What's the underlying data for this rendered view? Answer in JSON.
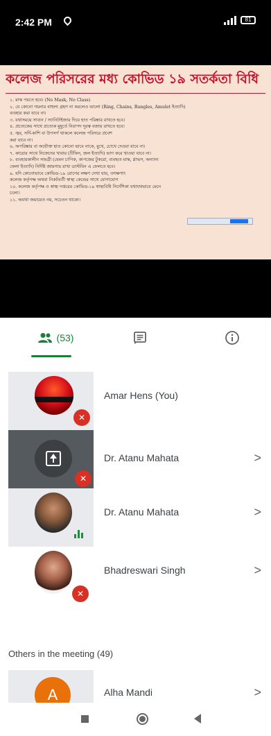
{
  "status_bar": {
    "time": "2:42 PM",
    "battery": "81"
  },
  "slide": {
    "title": "কলেজ পরিসরের মধ্য কোভিড ১৯ সতর্কতা বিধি",
    "lines": [
      "১. মাস্ক পরতে হবে। (No Mask, No Class)",
      "২. যে কোনো গয়নার বাহুল্য গ্রহণ না করলেও ভালো (Ring, Chains, Bangles, Amulet ইত্যাদি)",
      "   ব্যবহার করা যাবে না।",
      "৩. যথাসময়ে সাবান / স্যানিটাইজার দিয়ে হাত পরিষ্কার রাখতে হবে।",
      "৪. প্রত্যেকের সাথে প্রত্যেক মুহূর্তে নিরাপদ দূরত্ব বজায় রাখতে হবে।",
      "৫. জ্বর, সর্দি-কাশি বা উপসর্গ থাকলে কলেজ পরিসরে প্রবেশ",
      "   করা যাবে না।",
      "৬. অপরিষ্কার বা অযৌক্ত হাত কোনো ভাবে নাকে, মুখে, চোখে দেওয়া যাবে না।",
      "৭. কারোর সাথে নিজেদের খাবার (টিফিন, জল ইত্যাদি) ভাগ করে খাওয়া যাবে না।",
      "৮. ব্যবহারকালীন সামগ্রী (যেমন চাপিক, কাপজের টুকরো, ব্যবহৃত মাস্ক, গ্লাভস, অন্যান্য",
      "   ফেলা ইত্যাদি) নির্দিষ্ট জায়গায় রাখা ডাস্টবিন এ ফেলতে হবে।",
      "৯. যদি কোনোভাবে কোভিড-১৯ রোগের লক্ষণ দেখা যায়, তৎক্ষণাৎ",
      "   কলেজ কর্তৃপক্ষ অথবা নিকটবর্তী স্বাস্থ্য কেন্দ্রের সাথে যোগাযোগ",
      "১০. কলেজ কর্তৃপক্ষ ও স্বাস্থ্য দপ্তরের কোভিড-১৯ স্বাস্থ্যবিধি নির্দেশিকা যথাযথভাবে মেনে",
      "   চলো।",
      "১১. অযথা জমায়েত নয়, সচেতন থাকো।"
    ]
  },
  "tabs": {
    "people_count": "(53)"
  },
  "participants": [
    {
      "name": "Amar Hens (You)",
      "muted": true,
      "chevron": ""
    },
    {
      "name": "Dr. Atanu Mahata",
      "muted": true,
      "chevron": ">"
    },
    {
      "name": "Dr. Atanu Mahata",
      "muted": false,
      "chevron": ">"
    },
    {
      "name": "Bhadreswari Singh",
      "muted": true,
      "chevron": ">"
    }
  ],
  "others": {
    "title": "Others in the meeting (49)",
    "items": [
      {
        "name": "Alha Mandi",
        "initial": "A",
        "chevron": ">"
      }
    ]
  },
  "colors": {
    "accent_green": "#188038",
    "mic_off_red": "#d93025",
    "avatar_orange": "#e8710a",
    "slide_title_red": "#c4122a"
  }
}
